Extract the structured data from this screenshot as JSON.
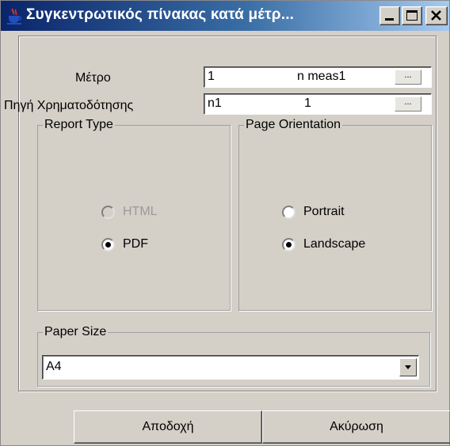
{
  "window": {
    "title": "Συγκεντρωτικός πίνακας κατά μέτρ...",
    "icon": "java-coffee-icon",
    "controls": [
      "minimize",
      "maximize",
      "close"
    ]
  },
  "form": {
    "metro": {
      "label": "Μέτρο",
      "code": "1",
      "name": "n meas1",
      "lookup_label": "..."
    },
    "source": {
      "label": "Πηγή Χρηματοδότησης",
      "code": "n1",
      "name": "1",
      "lookup_label": "..."
    }
  },
  "report_type": {
    "legend": "Report Type",
    "options": [
      {
        "label": "HTML",
        "selected": false,
        "enabled": false
      },
      {
        "label": "PDF",
        "selected": true,
        "enabled": true
      }
    ]
  },
  "orientation": {
    "legend": "Page Orientation",
    "options": [
      {
        "label": "Portrait",
        "selected": false
      },
      {
        "label": "Landscape",
        "selected": true
      }
    ]
  },
  "paper_size": {
    "legend": "Paper Size",
    "value": "A4"
  },
  "buttons": {
    "accept": "Αποδοχή",
    "cancel": "Ακύρωση"
  },
  "colors": {
    "titlebar_start": "#0a246a",
    "titlebar_end": "#a6caf0",
    "face": "#d4d0c8"
  }
}
